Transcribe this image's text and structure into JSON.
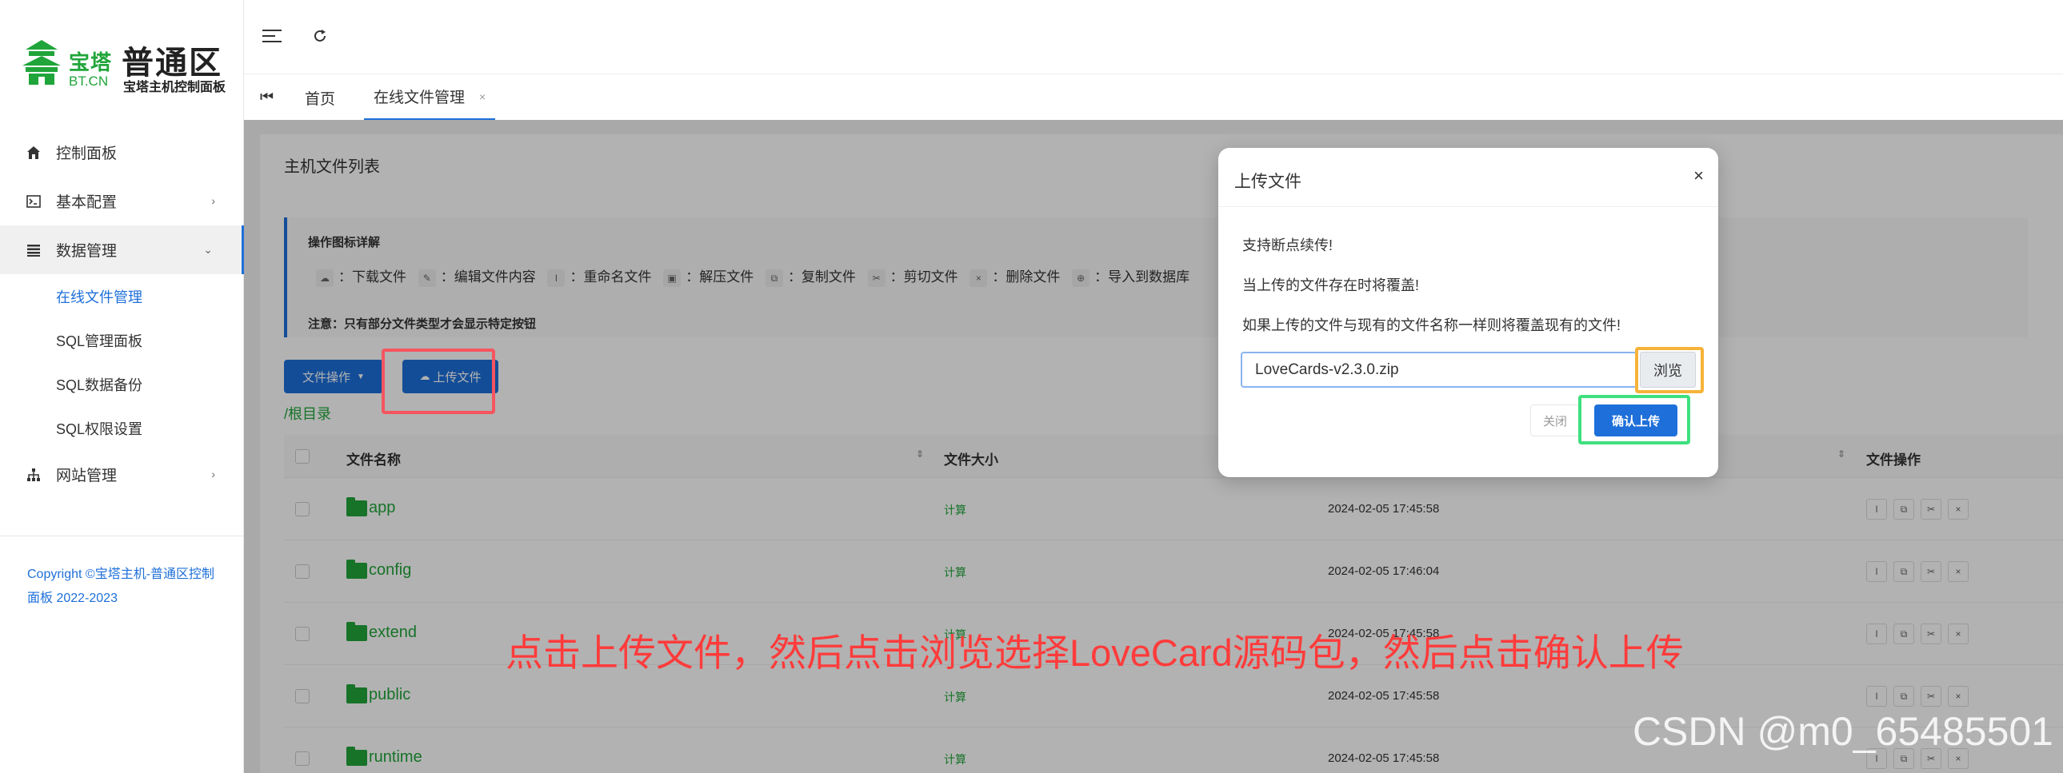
{
  "brand": {
    "bt": "宝塔",
    "cn": "BT.CN",
    "title": "普通区",
    "subtitle": "宝塔主机控制面板",
    "accent": "#20a53a"
  },
  "sidebar": {
    "items": [
      {
        "label": "控制面板",
        "icon": "home-icon"
      },
      {
        "label": "基本配置",
        "icon": "terminal-icon"
      },
      {
        "label": "数据管理",
        "icon": "list-icon"
      },
      {
        "label": "网站管理",
        "icon": "sitemap-icon"
      }
    ],
    "sub_items": [
      "在线文件管理",
      "SQL管理面板",
      "SQL数据备份",
      "SQL权限设置"
    ],
    "copyright": "Copyright ©宝塔主机-普通区控制面板 2022-2023"
  },
  "tabs": [
    {
      "label": "首页"
    },
    {
      "label": "在线文件管理"
    }
  ],
  "panel": {
    "title": "主机文件列表",
    "info_heading": "操作图标详解",
    "info_ops": [
      "：下载文件",
      "：编辑文件内容",
      "：重命名文件",
      "：解压文件",
      "：复制文件",
      "：剪切文件",
      "：删除文件",
      "：导入到数据库"
    ],
    "info_note": "注意：只有部分文件类型才会显示特定按钮",
    "file_ops_label": "文件操作",
    "upload_label": "上传文件",
    "breadcrumb": "/根目录",
    "columns": [
      "文件名称",
      "文件大小",
      "文件操作"
    ]
  },
  "rows": [
    {
      "name": "app",
      "size": "计算",
      "date": "2024-02-05 17:45:58"
    },
    {
      "name": "config",
      "size": "计算",
      "date": "2024-02-05 17:46:04"
    },
    {
      "name": "extend",
      "size": "计算",
      "date": "2024-02-05 17:45:58"
    },
    {
      "name": "public",
      "size": "计算",
      "date": "2024-02-05 17:45:58"
    },
    {
      "name": "runtime",
      "size": "计算",
      "date": "2024-02-05 17:45:58"
    }
  ],
  "modal": {
    "title": "上传文件",
    "line1": "支持断点续传!",
    "line2": "当上传的文件存在时将覆盖!",
    "line3": "如果上传的文件与现有的文件名称一样则将覆盖现有的文件!",
    "file_value": "LoveCards-v2.3.0.zip",
    "browse_label": "浏览",
    "close_label": "关闭",
    "confirm_label": "确认上传"
  },
  "annotation": "点击上传文件，然后点击浏览选择LoveCard源码包，然后点击确认上传",
  "watermark": "CSDN @m0_65485501",
  "colors": {
    "primary": "#1e6fd9",
    "highlight_red": "#f5555f",
    "highlight_orange": "#f6b339",
    "highlight_green": "#3ee07e"
  }
}
